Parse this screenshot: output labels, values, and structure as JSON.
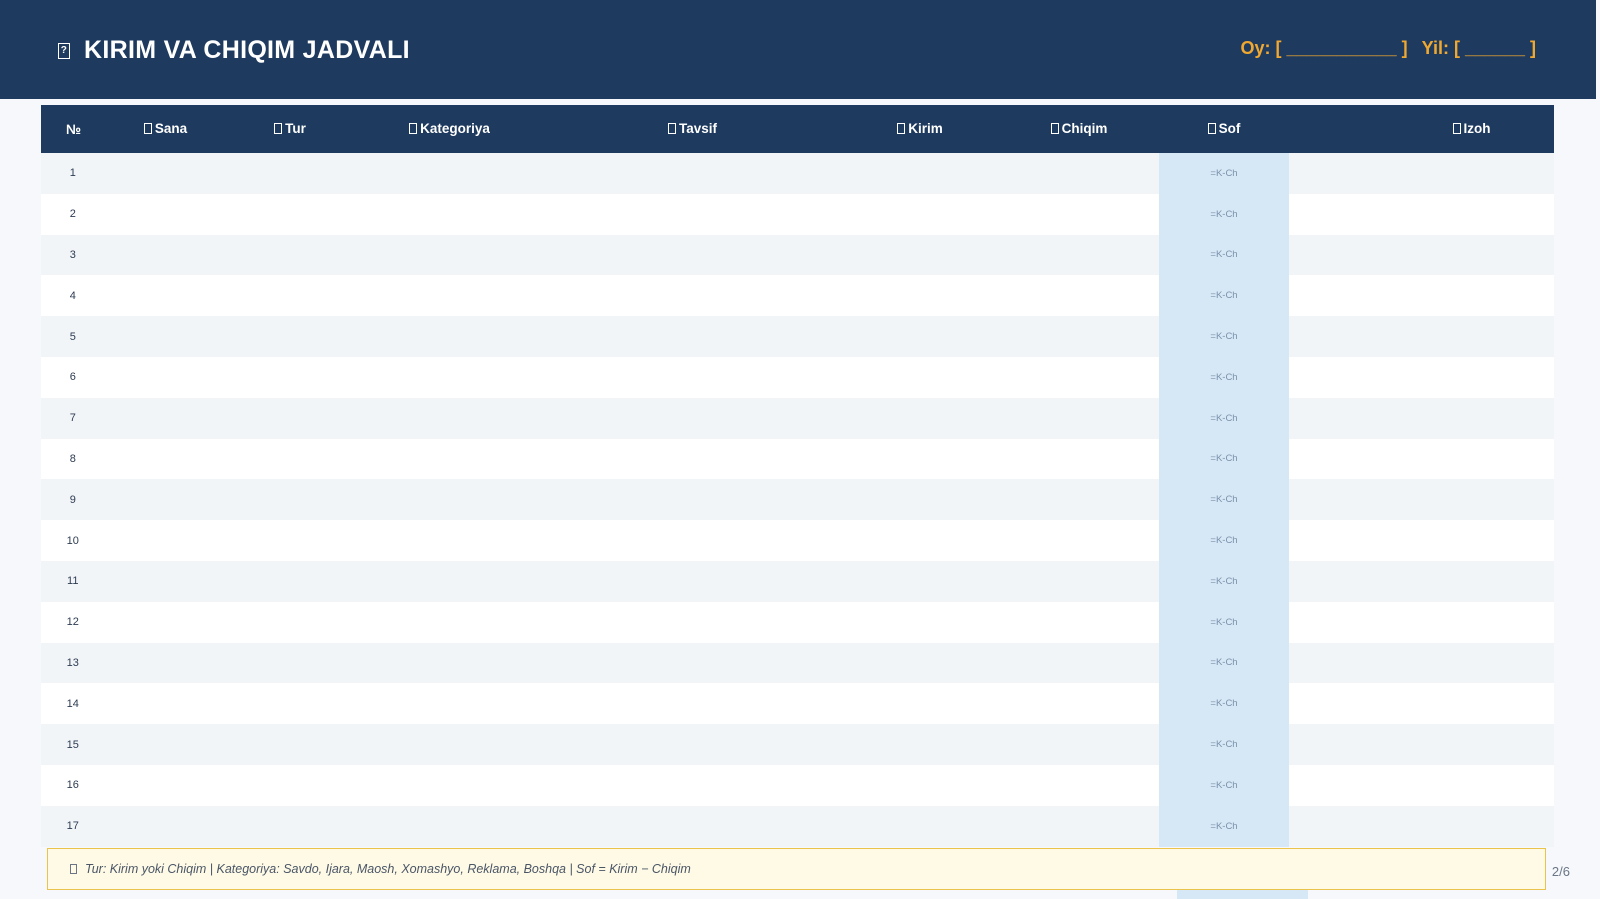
{
  "header": {
    "title": "KIRIM VA CHIQIM JADVALI",
    "title_icon": "document-icon",
    "month_label": "Oy: [ ___________ ]",
    "year_label": "Yil: [ ______ ]"
  },
  "table": {
    "columns": [
      {
        "label": "№",
        "icon": ""
      },
      {
        "label": "Sana",
        "icon": "calendar-icon"
      },
      {
        "label": "Tur",
        "icon": "tag-icon"
      },
      {
        "label": "Kategoriya",
        "icon": "label-icon"
      },
      {
        "label": "Tavsif",
        "icon": "note-icon"
      },
      {
        "label": "Kirim",
        "icon": "money-bag-icon"
      },
      {
        "label": "Chiqim",
        "icon": "money-out-icon"
      },
      {
        "label": "Sof",
        "icon": "bar-chart-icon"
      },
      {
        "label": "Izoh",
        "icon": "memo-icon"
      }
    ],
    "rows": [
      {
        "n": "1",
        "sof": "=K-Ch"
      },
      {
        "n": "2",
        "sof": "=K-Ch"
      },
      {
        "n": "3",
        "sof": "=K-Ch"
      },
      {
        "n": "4",
        "sof": "=K-Ch"
      },
      {
        "n": "5",
        "sof": "=K-Ch"
      },
      {
        "n": "6",
        "sof": "=K-Ch"
      },
      {
        "n": "7",
        "sof": "=K-Ch"
      },
      {
        "n": "8",
        "sof": "=K-Ch"
      },
      {
        "n": "9",
        "sof": "=K-Ch"
      },
      {
        "n": "10",
        "sof": "=K-Ch"
      },
      {
        "n": "11",
        "sof": "=K-Ch"
      },
      {
        "n": "12",
        "sof": "=K-Ch"
      },
      {
        "n": "13",
        "sof": "=K-Ch"
      },
      {
        "n": "14",
        "sof": "=K-Ch"
      },
      {
        "n": "15",
        "sof": "=K-Ch"
      },
      {
        "n": "16",
        "sof": "=K-Ch"
      },
      {
        "n": "17",
        "sof": "=K-Ch"
      }
    ]
  },
  "note": {
    "text": "Tur: Kirim yoki Chiqim  |  Kategoriya: Savdo, Ijara, Maosh, Xomashyo, Reklama, Boshqa  |  Sof = Kirim − Chiqim",
    "icon": "pin-icon"
  },
  "page": {
    "number": "2/6"
  },
  "colors": {
    "header_bg": "#1e3a5f",
    "accent": "#f0a830",
    "sof_column": "#d6e7f5",
    "note_bg": "#fefae6",
    "note_border": "#e9c34a"
  }
}
